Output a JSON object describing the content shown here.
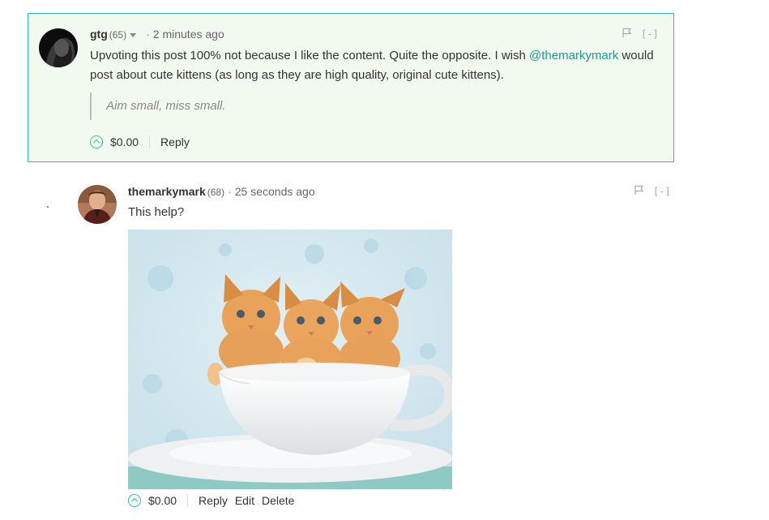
{
  "comments": [
    {
      "author": "gtg",
      "reputation": "(65)",
      "dot": "·",
      "time": "2 minutes ago",
      "body_before_mention": "Upvoting this post 100% not because I like the content. Quite the opposite. I wish ",
      "mention": "@themarkymark",
      "body_after_mention": " would post about cute kittens (as long as they are high quality, original cute kittens).",
      "quote": "Aim small, miss small.",
      "payout": "$0.00",
      "actions": [
        "Reply"
      ],
      "collapse_label": "[-]",
      "highlighted": true
    },
    {
      "author": "themarkymark",
      "reputation": "(68)",
      "dot": "·",
      "time": "25 seconds ago",
      "body": "This help?",
      "payout": "$0.00",
      "actions": [
        "Reply",
        "Edit",
        "Delete"
      ],
      "collapse_label": "[-]",
      "image": "kittens-in-teacup"
    }
  ],
  "colors": {
    "accent": "#2cc3a4",
    "highlight_bg": "#f2faf0",
    "mention": "#1a9e86"
  }
}
